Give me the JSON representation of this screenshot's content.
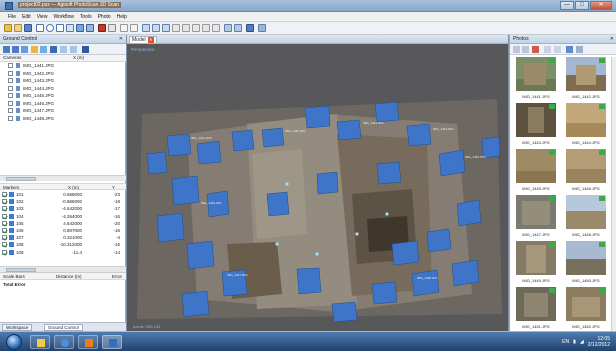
{
  "window": {
    "title": "project02.psx — Agisoft PhotoScan 3D Scan",
    "buttons": {
      "minimize": "—",
      "maximize": "□",
      "close": "✕"
    }
  },
  "menu": [
    "File",
    "Edit",
    "View",
    "Workflow",
    "Tools",
    "Photo",
    "Help"
  ],
  "left_panel": {
    "title": "Ground Control",
    "close": "✕",
    "cameras": {
      "header": "Cameras",
      "col2": "X (m)",
      "items": [
        "IMG_1441.JPG",
        "IMG_1442.JPG",
        "IMG_1443.JPG",
        "IMG_1444.JPG",
        "IMG_1445.JPG",
        "IMG_1446.JPG",
        "IMG_1447.JPG",
        "IMG_1448.JPG"
      ]
    },
    "markers": {
      "header": "Markers",
      "col2": "X (m)",
      "col3": "Y",
      "rows": [
        {
          "name": "101",
          "x": "0.668000",
          "y": "-23"
        },
        {
          "name": "102",
          "x": "-0.866000",
          "y": "-18"
        },
        {
          "name": "103",
          "x": "-4.642000",
          "y": "-17"
        },
        {
          "name": "104",
          "x": "-4.264000",
          "y": "-16"
        },
        {
          "name": "105",
          "x": "4.642000",
          "y": "-20"
        },
        {
          "name": "106",
          "x": "0.807000",
          "y": "-16"
        },
        {
          "name": "107",
          "x": "0.321000",
          "y": "-4"
        },
        {
          "name": "108",
          "x": "-10.312000",
          "y": "-16"
        },
        {
          "name": "109",
          "x": "-11.4",
          "y": "-14"
        }
      ]
    },
    "scale_bars": {
      "col1": "Scale Bars",
      "col2": "Distance (m)",
      "col3": "Error"
    },
    "total_error": "Total Error",
    "tabs": [
      "Workspace",
      "Ground Control"
    ]
  },
  "model": {
    "tab_label": "Model",
    "view_label": "Perspective",
    "status": "points: 306,133"
  },
  "photos": {
    "title": "Photos",
    "items": [
      {
        "label": "IMG_1441.JPG",
        "tone": "#6b7a55"
      },
      {
        "label": "IMG_1442.JPG",
        "tone": "#7d6e52"
      },
      {
        "label": "IMG_1443.JPG",
        "tone": "#5d5140"
      },
      {
        "label": "IMG_1444.JPG",
        "tone": "#a88a5a"
      },
      {
        "label": "IMG_1445.JPG",
        "tone": "#8a7550"
      },
      {
        "label": "IMG_1446.JPG",
        "tone": "#9a8460"
      },
      {
        "label": "IMG_1447.JPG",
        "tone": "#7a7a70"
      },
      {
        "label": "IMG_1448.JPG",
        "tone": "#9a8a6a"
      },
      {
        "label": "IMG_1449.JPG",
        "tone": "#857a66"
      },
      {
        "label": "IMG_1450.JPG",
        "tone": "#77705c"
      },
      {
        "label": "IMG_1451.JPG",
        "tone": "#6d6a5a"
      },
      {
        "label": "IMG_1452.JPG",
        "tone": "#8d7d60"
      }
    ]
  },
  "taskbar": {
    "time": "12:05",
    "date": "2/12/2012",
    "lang": "EN"
  },
  "colors": {
    "camera_plane": "#3e75c9",
    "accent": "#3a7bd5",
    "title_bar": "#9db8d4"
  }
}
